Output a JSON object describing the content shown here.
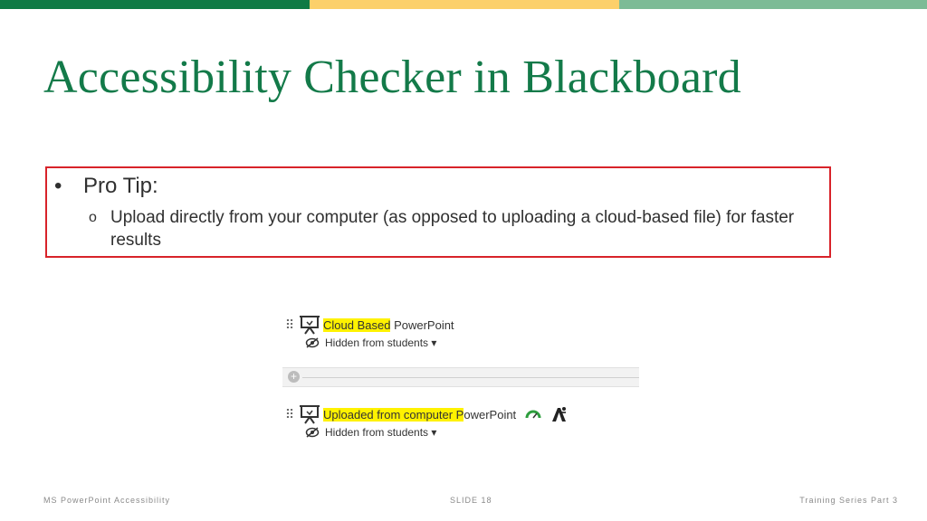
{
  "slide": {
    "title": "Accessibility Checker in Blackboard",
    "tip": {
      "bullet": "•",
      "heading": "Pro Tip:",
      "sub_bullet": "o",
      "detail": "Upload directly from your computer (as opposed to uploading a cloud-based file) for faster results"
    }
  },
  "screenshot": {
    "items": [
      {
        "highlight": "Cloud Based",
        "rest": " PowerPoint",
        "visibility": "Hidden from students ▾"
      },
      {
        "highlight": "Uploaded from computer P",
        "rest": "owerPoint",
        "visibility": "Hidden from students ▾"
      }
    ],
    "divider_plus": "+"
  },
  "footer": {
    "left": "MS PowerPoint Accessibility",
    "center": "SLIDE 18",
    "right": "Training Series Part 3"
  },
  "colors": {
    "brand_green": "#137a49",
    "bar_green": "#0f7a45",
    "bar_yellow": "#fcd06a",
    "bar_light_green": "#7cbb96",
    "box_red": "#d8232a",
    "highlight": "#fff200"
  }
}
